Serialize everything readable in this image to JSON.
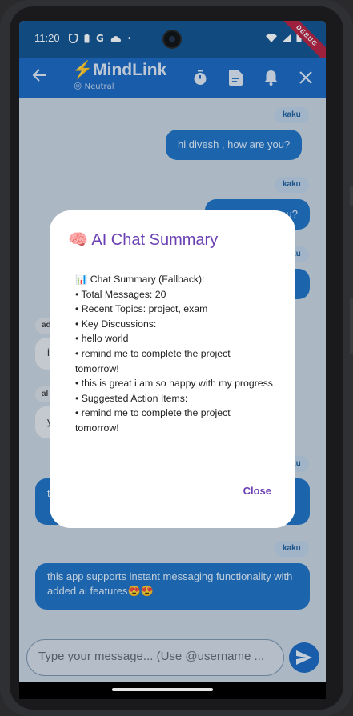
{
  "status_bar": {
    "time": "11:20",
    "left_icons": [
      "shield-icon",
      "battery-saver-icon",
      "google-icon",
      "cloud-icon",
      "dot-icon"
    ],
    "right_icons": [
      "wifi-icon",
      "signal-icon",
      "battery-icon"
    ],
    "debug_label": "DEBUG"
  },
  "app_bar": {
    "title_emoji": "⚡",
    "title": "MindLink",
    "mood": "😐 Neutral",
    "actions": [
      "timer-icon",
      "summary-doc-icon",
      "notifications-icon",
      "close-icon"
    ]
  },
  "chat": {
    "messages": [
      {
        "sender": "kaku",
        "text": "hi divesh , how are you?",
        "direction": "out"
      },
      {
        "sender": "kaku",
        "text": "...you?",
        "direction": "out"
      },
      {
        "sender": "kaku",
        "text": "",
        "direction": "out"
      },
      {
        "sender": "ad",
        "text": "i",
        "direction": "in"
      },
      {
        "sender": "al",
        "text": "y",
        "direction": "in"
      },
      {
        "sender": "kaku",
        "text": "t",
        "direction": "out"
      },
      {
        "sender": "kaku",
        "text": "this app supports instant messaging functionality with added ai features😍😍",
        "direction": "out"
      }
    ]
  },
  "input": {
    "placeholder": "Type your message... (Use @username ..."
  },
  "dialog": {
    "title": "🧠 AI Chat Summary",
    "lines": [
      "📊 Chat Summary (Fallback):",
      "• Total Messages: 20",
      "• Recent Topics: project, exam",
      "• Key Discussions:",
      "• hello world",
      "• remind me to complete the project tomorrow!",
      "• this is great i am so happy with my progress",
      "• Suggested Action Items:",
      "• remind me to complete the project tomorrow!"
    ],
    "close_label": "Close"
  },
  "colors": {
    "app_bar": "#1565c0",
    "status_bar": "#0d4f8c",
    "bubble_out": "#1a6fc4",
    "dialog_accent": "#6a3fb3",
    "chat_bg": "#c9d3dd"
  }
}
